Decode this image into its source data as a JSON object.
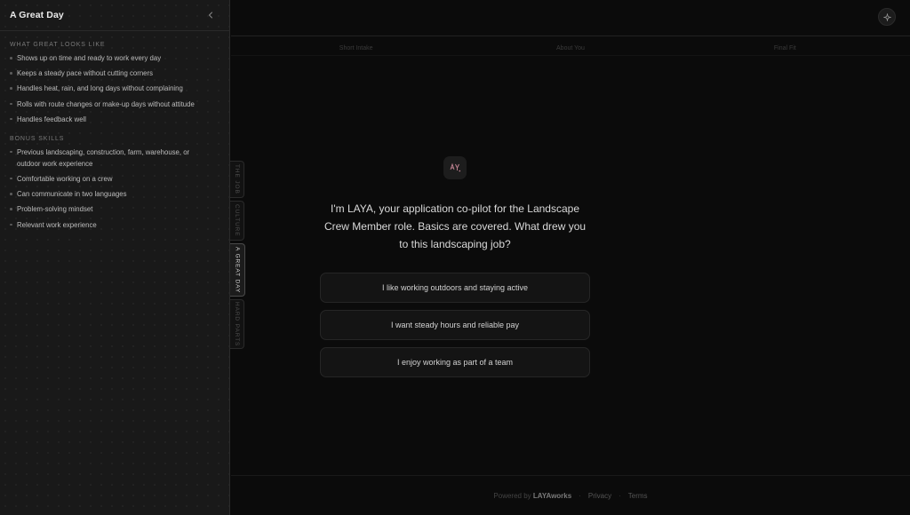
{
  "sidebar": {
    "title": "A Great Day",
    "sections": [
      {
        "heading": "WHAT GREAT LOOKS LIKE",
        "items": [
          "Shows up on time and ready to work every day",
          "Keeps a steady pace without cutting corners",
          "Handles heat, rain, and long days without complaining",
          "Rolls with route changes or make-up days without attitude",
          "Handles feedback well"
        ]
      },
      {
        "heading": "BONUS SKILLS",
        "items": [
          "Previous landscaping, construction, farm, warehouse, or outdoor work experience",
          "Comfortable working on a crew",
          "Can communicate in two languages",
          "Problem-solving mindset",
          "Relevant work experience"
        ]
      }
    ]
  },
  "tabs": [
    {
      "label": "THE JOB",
      "active": false
    },
    {
      "label": "CULTURE",
      "active": false
    },
    {
      "label": "A GREAT DAY",
      "active": true
    },
    {
      "label": "HARD PARTS",
      "active": false
    }
  ],
  "steps": [
    "Short Intake",
    "About You",
    "Final Fit"
  ],
  "main": {
    "intro": "I'm LAYA, your application co-pilot for the Landscape Crew Member role. Basics are covered. What drew you to this landscaping job?",
    "options": [
      "I like working outdoors and staying active",
      "I want steady hours and reliable pay",
      "I enjoy working as part of a team"
    ]
  },
  "footer": {
    "powered": "Powered by",
    "brand": "LAYAworks",
    "separator": "·",
    "privacy": "Privacy",
    "terms": "Terms"
  },
  "icons": {
    "collapse": "chevron-left-icon",
    "top_action": "sparkle-icon",
    "assistant": "laya-logo-icon"
  },
  "colors": {
    "background": "#0b0b0b",
    "panel": "#191919",
    "accent_pink": "#d08a9a"
  }
}
